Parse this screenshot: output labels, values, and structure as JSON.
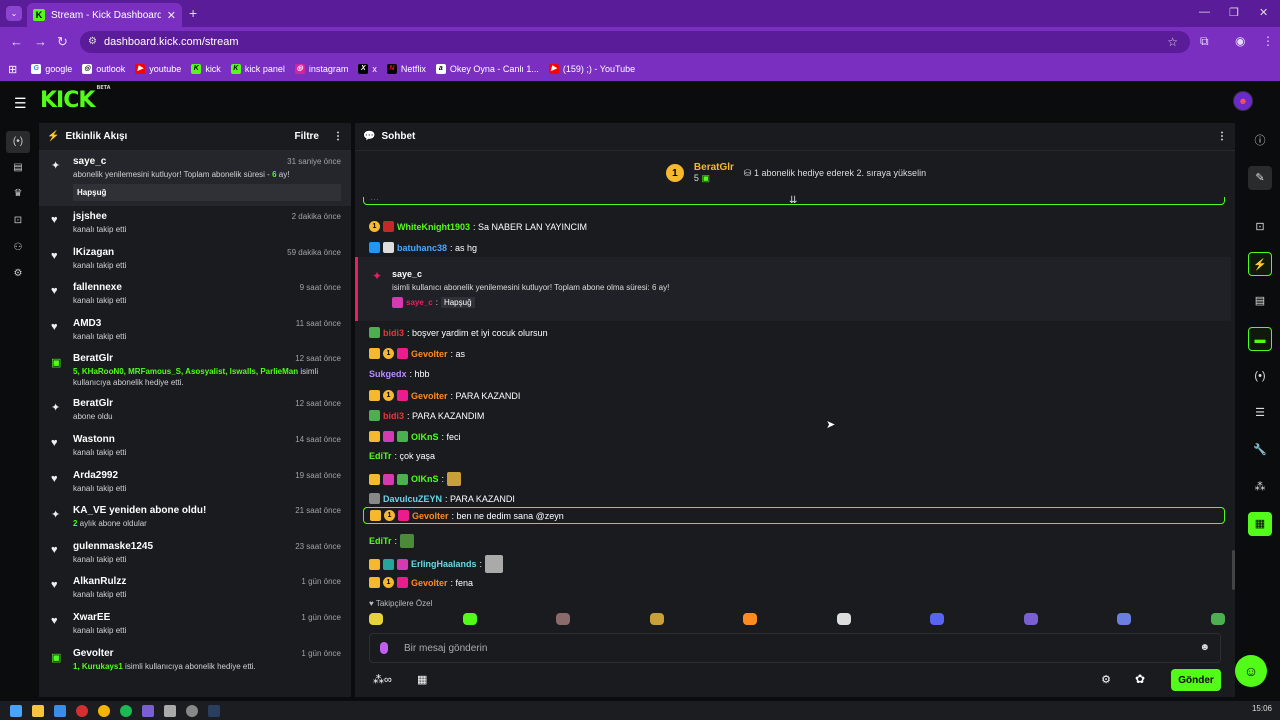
{
  "browser": {
    "tab_title": "Stream - Kick Dashboard",
    "url": "dashboard.kick.com/stream",
    "bookmarks": [
      "google",
      "outlook",
      "youtube",
      "kick",
      "kick panel",
      "instagram",
      "x",
      "Netflix",
      "Okey Oyna - Canlı 1...",
      "(159) ;) - YouTube"
    ]
  },
  "app": {
    "logo": "KICK",
    "logo_tag": "BETA"
  },
  "events": {
    "title": "Etkinlik Akışı",
    "filter_label": "Filtre",
    "items": [
      {
        "name": "saye_c",
        "sub": "abonelik yenilemesini kutluyor! Toplam abonelik süresi - ",
        "sub_hl": "6",
        "sub_end": " ay!",
        "time": "31 saniye önce",
        "msg": "Hapşuğ"
      },
      {
        "name": "jsjshee",
        "sub": "kanalı takip etti",
        "time": "2 dakika önce"
      },
      {
        "name": "lKizagan",
        "sub": "kanalı takip etti",
        "time": "59 dakika önce"
      },
      {
        "name": "fallennexe",
        "sub": "kanalı takip etti",
        "time": "9 saat önce"
      },
      {
        "name": "AMD3",
        "sub": "kanalı takip etti",
        "time": "11 saat önce"
      },
      {
        "name": "BeratGlr",
        "sub_hl": "5, KHaRooN0, MRFamous_S, Asosyalist, lswalls, ParlieMan",
        "sub": " isimli kullanıcıya abonelik hediye etti.",
        "time": "12 saat önce"
      },
      {
        "name": "BeratGlr",
        "sub": "abone oldu",
        "time": "12 saat önce"
      },
      {
        "name": "Wastonn",
        "sub": "kanalı takip etti",
        "time": "14 saat önce"
      },
      {
        "name": "Arda2992",
        "sub": "kanalı takip etti",
        "time": "19 saat önce"
      },
      {
        "name": "KA_VE yeniden abone oldu!",
        "sub_hl": "2",
        "sub": " aylık abone oldular",
        "time": "21 saat önce"
      },
      {
        "name": "gulenmaske1245",
        "sub": "kanalı takip etti",
        "time": "23 saat önce"
      },
      {
        "name": "AlkanRulzz",
        "sub": "kanalı takip etti",
        "time": "1 gün önce"
      },
      {
        "name": "XwarEE",
        "sub": "kanalı takip etti",
        "time": "1 gün önce"
      },
      {
        "name": "Gevolter",
        "sub_hl": "1, Kurukays1",
        "sub": " isimli kullanıcıya abonelik hediye etti.",
        "time": "1 gün önce"
      }
    ]
  },
  "chat": {
    "title": "Sohbet",
    "pinned": {
      "rank": "1",
      "name": "BeratGlr",
      "count": "5",
      "message": "1 abonelik hediye ederek 2. sıraya yükselin"
    },
    "messages": [
      {
        "user": "WhiteKnight1903",
        "color": "#53fc18",
        "text": ": Sa NABER LAN YAYINCIM"
      },
      {
        "user": "batuhanc38",
        "color": "#4aa8ff",
        "text": ": as hg"
      },
      {
        "user": "bidi3",
        "color": "#e53935",
        "text": ": boşver yardim et iyi cocuk olursun"
      },
      {
        "user": "Gevolter",
        "color": "#ff8a1f",
        "text": ": as"
      },
      {
        "user": "Sukgedx",
        "color": "#b98cff",
        "text": ": hbb"
      },
      {
        "user": "Gevolter",
        "color": "#ff8a1f",
        "text": ": PARA KAZANDI"
      },
      {
        "user": "bidi3",
        "color": "#e53935",
        "text": ": PARA KAZANDIM"
      },
      {
        "user": "OlKnS",
        "color": "#53fc18",
        "text": ": feci"
      },
      {
        "user": "EdiTr",
        "color": "#53fc18",
        "text": ": çok yaşa"
      },
      {
        "user": "OlKnS",
        "color": "#53fc18",
        "text": ":"
      },
      {
        "user": "DavulcuZEYN",
        "color": "#6ad7e5",
        "text": ": PARA KAZANDI"
      },
      {
        "user": "Gevolter",
        "color": "#ff8a1f",
        "text": ": ben ne dedim sana @zeyn"
      },
      {
        "user": "EdiTr",
        "color": "#53fc18",
        "text": ":"
      },
      {
        "user": "ErlingHaalands",
        "color": "#6ad7e5",
        "text": ":"
      },
      {
        "user": "Gevolter",
        "color": "#ff8a1f",
        "text": ": fena"
      }
    ],
    "sub_card": {
      "name": "saye_c",
      "text": "isimli kullanıcı abonelik yenilemesini kutluyor! Toplam abone olma süresi: 6 ay!",
      "from": "saye_c",
      "msg": "Hapşuğ"
    },
    "followers_only": "Takipçilere Özel",
    "input_placeholder": "Bir mesaj gönderin",
    "send_label": "Gönder"
  },
  "tray": {
    "time": "15:06"
  }
}
